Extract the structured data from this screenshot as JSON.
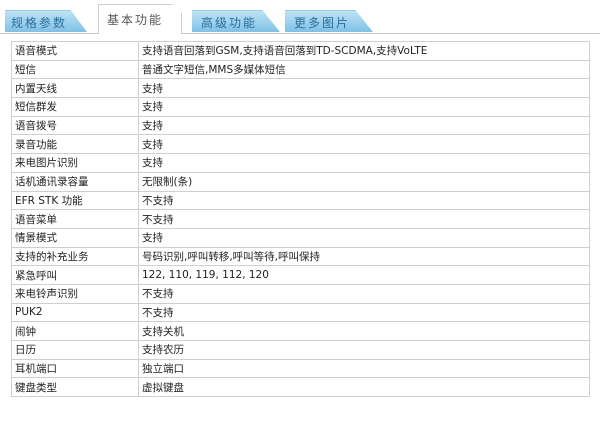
{
  "tabs": [
    {
      "label": "规格参数",
      "active": false
    },
    {
      "label": "基本功能",
      "active": true
    },
    {
      "label": "高级功能",
      "active": false
    },
    {
      "label": "更多图片",
      "active": false
    }
  ],
  "rows": [
    {
      "label": "语音模式",
      "value": "支持语音回落到GSM,支持语音回落到TD-SCDMA,支持VoLTE"
    },
    {
      "label": "短信",
      "value": "普通文字短信,MMS多媒体短信"
    },
    {
      "label": "内置天线",
      "value": "支持"
    },
    {
      "label": "短信群发",
      "value": "支持"
    },
    {
      "label": "语音拨号",
      "value": "支持"
    },
    {
      "label": "录音功能",
      "value": "支持"
    },
    {
      "label": "来电图片识别",
      "value": "支持"
    },
    {
      "label": "话机通讯录容量",
      "value": "无限制(条)"
    },
    {
      "label": "EFR STK 功能",
      "value": "不支持"
    },
    {
      "label": "语音菜单",
      "value": "不支持"
    },
    {
      "label": "情景模式",
      "value": "支持"
    },
    {
      "label": "支持的补充业务",
      "value": "号码识别,呼叫转移,呼叫等待,呼叫保持"
    },
    {
      "label": "紧急呼叫",
      "value": "122, 110, 119, 112, 120"
    },
    {
      "label": "来电铃声识别",
      "value": "不支持"
    },
    {
      "label": "PUK2",
      "value": "不支持"
    },
    {
      "label": "闹钟",
      "value": "支持关机"
    },
    {
      "label": "日历",
      "value": "支持农历"
    },
    {
      "label": "耳机端口",
      "value": "独立端口"
    },
    {
      "label": "键盘类型",
      "value": "虚拟键盘"
    }
  ]
}
